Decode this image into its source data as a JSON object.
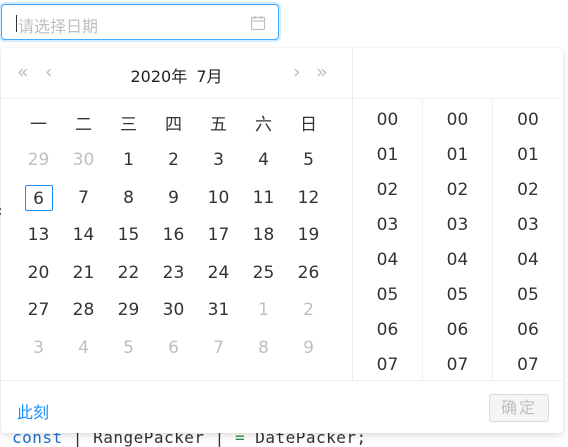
{
  "input": {
    "placeholder": "请选择日期",
    "icon": "calendar-icon"
  },
  "header": {
    "year_label": "2020年",
    "month_label": "7月",
    "prev_year": "«",
    "prev_month": "‹",
    "next_month": "›",
    "next_year": "»"
  },
  "weekdays": [
    "一",
    "二",
    "三",
    "四",
    "五",
    "六",
    "日"
  ],
  "days": [
    [
      {
        "d": "29",
        "dim": true
      },
      {
        "d": "30",
        "dim": true
      },
      {
        "d": "1"
      },
      {
        "d": "2"
      },
      {
        "d": "3"
      },
      {
        "d": "4"
      },
      {
        "d": "5"
      }
    ],
    [
      {
        "d": "6",
        "today": true
      },
      {
        "d": "7"
      },
      {
        "d": "8"
      },
      {
        "d": "9"
      },
      {
        "d": "10"
      },
      {
        "d": "11"
      },
      {
        "d": "12"
      }
    ],
    [
      {
        "d": "13"
      },
      {
        "d": "14"
      },
      {
        "d": "15"
      },
      {
        "d": "16"
      },
      {
        "d": "17"
      },
      {
        "d": "18"
      },
      {
        "d": "19"
      }
    ],
    [
      {
        "d": "20"
      },
      {
        "d": "21"
      },
      {
        "d": "22"
      },
      {
        "d": "23"
      },
      {
        "d": "24"
      },
      {
        "d": "25"
      },
      {
        "d": "26"
      }
    ],
    [
      {
        "d": "27"
      },
      {
        "d": "28"
      },
      {
        "d": "29"
      },
      {
        "d": "30"
      },
      {
        "d": "31"
      },
      {
        "d": "1",
        "dim": true
      },
      {
        "d": "2",
        "dim": true
      }
    ],
    [
      {
        "d": "3",
        "dim": true
      },
      {
        "d": "4",
        "dim": true
      },
      {
        "d": "5",
        "dim": true
      },
      {
        "d": "6",
        "dim": true
      },
      {
        "d": "7",
        "dim": true
      },
      {
        "d": "8",
        "dim": true
      },
      {
        "d": "9",
        "dim": true
      }
    ]
  ],
  "time": {
    "hours": [
      "00",
      "01",
      "02",
      "03",
      "04",
      "05",
      "06",
      "07"
    ],
    "minutes": [
      "00",
      "01",
      "02",
      "03",
      "04",
      "05",
      "06",
      "07"
    ],
    "seconds": [
      "00",
      "01",
      "02",
      "03",
      "04",
      "05",
      "06",
      "07"
    ]
  },
  "footer": {
    "now_label": "此刻",
    "ok_label": "确定"
  },
  "background_code": {
    "kw": "const",
    "mid": " | RangePacker | ",
    "op": "=",
    "tail": " DatePacker;"
  },
  "colors": {
    "accent": "#1890ff",
    "disabled_text": "#bfbfbf",
    "border": "#f0f0f0"
  }
}
